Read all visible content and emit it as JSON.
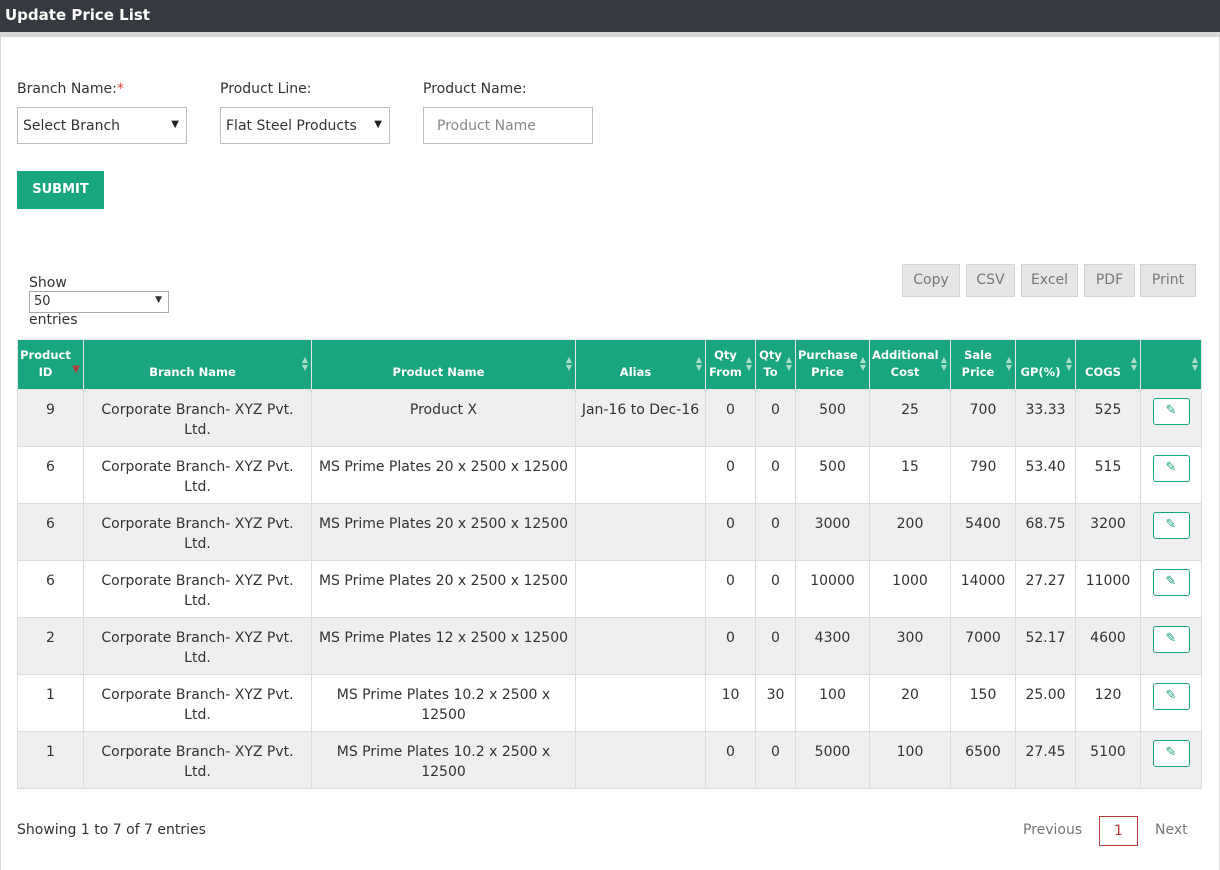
{
  "header": {
    "title": "Update Price List"
  },
  "filters": {
    "branch_label": "Branch Name:",
    "branch_required_mark": "*",
    "branch_value": "Select Branch",
    "product_line_label": "Product Line:",
    "product_line_value": "Flat Steel Products",
    "product_name_label": "Product Name:",
    "product_name_placeholder": "Product Name"
  },
  "submit_label": "SUBMIT",
  "length": {
    "show_label": "Show",
    "value": "50",
    "entries_label": "entries"
  },
  "export_buttons": [
    "Copy",
    "CSV",
    "Excel",
    "PDF",
    "Print"
  ],
  "table": {
    "columns": [
      "Product ID",
      "Branch Name",
      "Product Name",
      "Alias",
      "Qty From",
      "Qty To",
      "Purchase Price",
      "Additional Cost",
      "Sale Price",
      "GP(%)",
      "COGS",
      ""
    ],
    "rows": [
      [
        "9",
        "Corporate Branch- XYZ Pvt. Ltd.",
        "Product X",
        "Jan-16 to Dec-16",
        "0",
        "0",
        "500",
        "25",
        "700",
        "33.33",
        "525"
      ],
      [
        "6",
        "Corporate Branch- XYZ Pvt. Ltd.",
        "MS Prime Plates 20 x 2500 x 12500",
        "",
        "0",
        "0",
        "500",
        "15",
        "790",
        "53.40",
        "515"
      ],
      [
        "6",
        "Corporate Branch- XYZ Pvt. Ltd.",
        "MS Prime Plates 20 x 2500 x 12500",
        "",
        "0",
        "0",
        "3000",
        "200",
        "5400",
        "68.75",
        "3200"
      ],
      [
        "6",
        "Corporate Branch- XYZ Pvt. Ltd.",
        "MS Prime Plates 20 x 2500 x 12500",
        "",
        "0",
        "0",
        "10000",
        "1000",
        "14000",
        "27.27",
        "11000"
      ],
      [
        "2",
        "Corporate Branch- XYZ Pvt. Ltd.",
        "MS Prime Plates 12 x 2500 x 12500",
        "",
        "0",
        "0",
        "4300",
        "300",
        "7000",
        "52.17",
        "4600"
      ],
      [
        "1",
        "Corporate Branch- XYZ Pvt. Ltd.",
        "MS Prime Plates 10.2 x 2500 x 12500",
        "",
        "10",
        "30",
        "100",
        "20",
        "150",
        "25.00",
        "120"
      ],
      [
        "1",
        "Corporate Branch- XYZ Pvt. Ltd.",
        "MS Prime Plates 10.2 x 2500 x 12500",
        "",
        "0",
        "0",
        "5000",
        "100",
        "6500",
        "27.45",
        "5100"
      ]
    ]
  },
  "footer": {
    "info": "Showing 1 to 7 of 7 entries",
    "previous": "Previous",
    "current_page": "1",
    "next": "Next"
  },
  "colors": {
    "accent": "#18a57f",
    "header_bar": "#353a40",
    "sort_active": "#b63a3a"
  },
  "icons": {
    "edit": "pencil-icon",
    "dropdown": "caret-down-icon",
    "sort": "sort-arrows-icon"
  }
}
